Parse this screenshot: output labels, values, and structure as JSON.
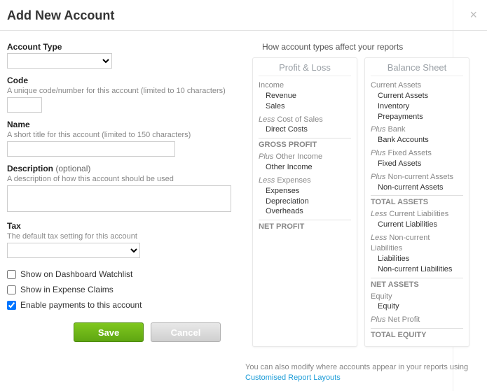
{
  "header": {
    "title": "Add New Account"
  },
  "form": {
    "accountType": {
      "label": "Account Type"
    },
    "code": {
      "label": "Code",
      "hint": "A unique code/number for this account (limited to 10 characters)"
    },
    "name": {
      "label": "Name",
      "hint": "A short title for this account (limited to 150 characters)"
    },
    "description": {
      "label": "Description",
      "optional": "(optional)",
      "hint": "A description of how this account should be used"
    },
    "tax": {
      "label": "Tax",
      "hint": "The default tax setting for this account"
    },
    "checks": {
      "dashboard": "Show on Dashboard Watchlist",
      "expense": "Show in Expense Claims",
      "payments": "Enable payments to this account"
    },
    "buttons": {
      "save": "Save",
      "cancel": "Cancel"
    }
  },
  "right": {
    "heading": "How account types affect your reports",
    "profitLoss": {
      "title": "Profit & Loss",
      "income": {
        "label": "Income",
        "items": [
          "Revenue",
          "Sales"
        ]
      },
      "costOfSales": {
        "mod": "Less",
        "label": "Cost of Sales",
        "items": [
          "Direct Costs"
        ]
      },
      "grossProfit": "GROSS PROFIT",
      "otherIncome": {
        "mod": "Plus",
        "label": "Other Income",
        "items": [
          "Other Income"
        ]
      },
      "expenses": {
        "mod": "Less",
        "label": "Expenses",
        "items": [
          "Expenses",
          "Depreciation",
          "Overheads"
        ]
      },
      "netProfit": "NET PROFIT"
    },
    "balanceSheet": {
      "title": "Balance Sheet",
      "currentAssets": {
        "label": "Current Assets",
        "items": [
          "Current Assets",
          "Inventory",
          "Prepayments"
        ]
      },
      "bank": {
        "mod": "Plus",
        "label": "Bank",
        "items": [
          "Bank Accounts"
        ]
      },
      "fixedAssets": {
        "mod": "Plus",
        "label": "Fixed Assets",
        "items": [
          "Fixed Assets"
        ]
      },
      "nonCurrentAssets": {
        "mod": "Plus",
        "label": "Non-current Assets",
        "items": [
          "Non-current Assets"
        ]
      },
      "totalAssets": "TOTAL ASSETS",
      "currentLiab": {
        "mod": "Less",
        "label": "Current Liabilities",
        "items": [
          "Current Liabilities"
        ]
      },
      "nonCurrentLiab": {
        "mod": "Less",
        "label": "Non-current Liabilities",
        "items": [
          "Liabilities",
          "Non-current Liabilities"
        ]
      },
      "netAssets": "NET ASSETS",
      "equity": {
        "label": "Equity",
        "items": [
          "Equity"
        ]
      },
      "plusNetProfit": {
        "mod": "Plus",
        "label": "Net Profit"
      },
      "totalEquity": "TOTAL EQUITY"
    },
    "footnote": {
      "text": "You can also modify where accounts appear in your reports using ",
      "link": "Customised Report Layouts"
    }
  }
}
